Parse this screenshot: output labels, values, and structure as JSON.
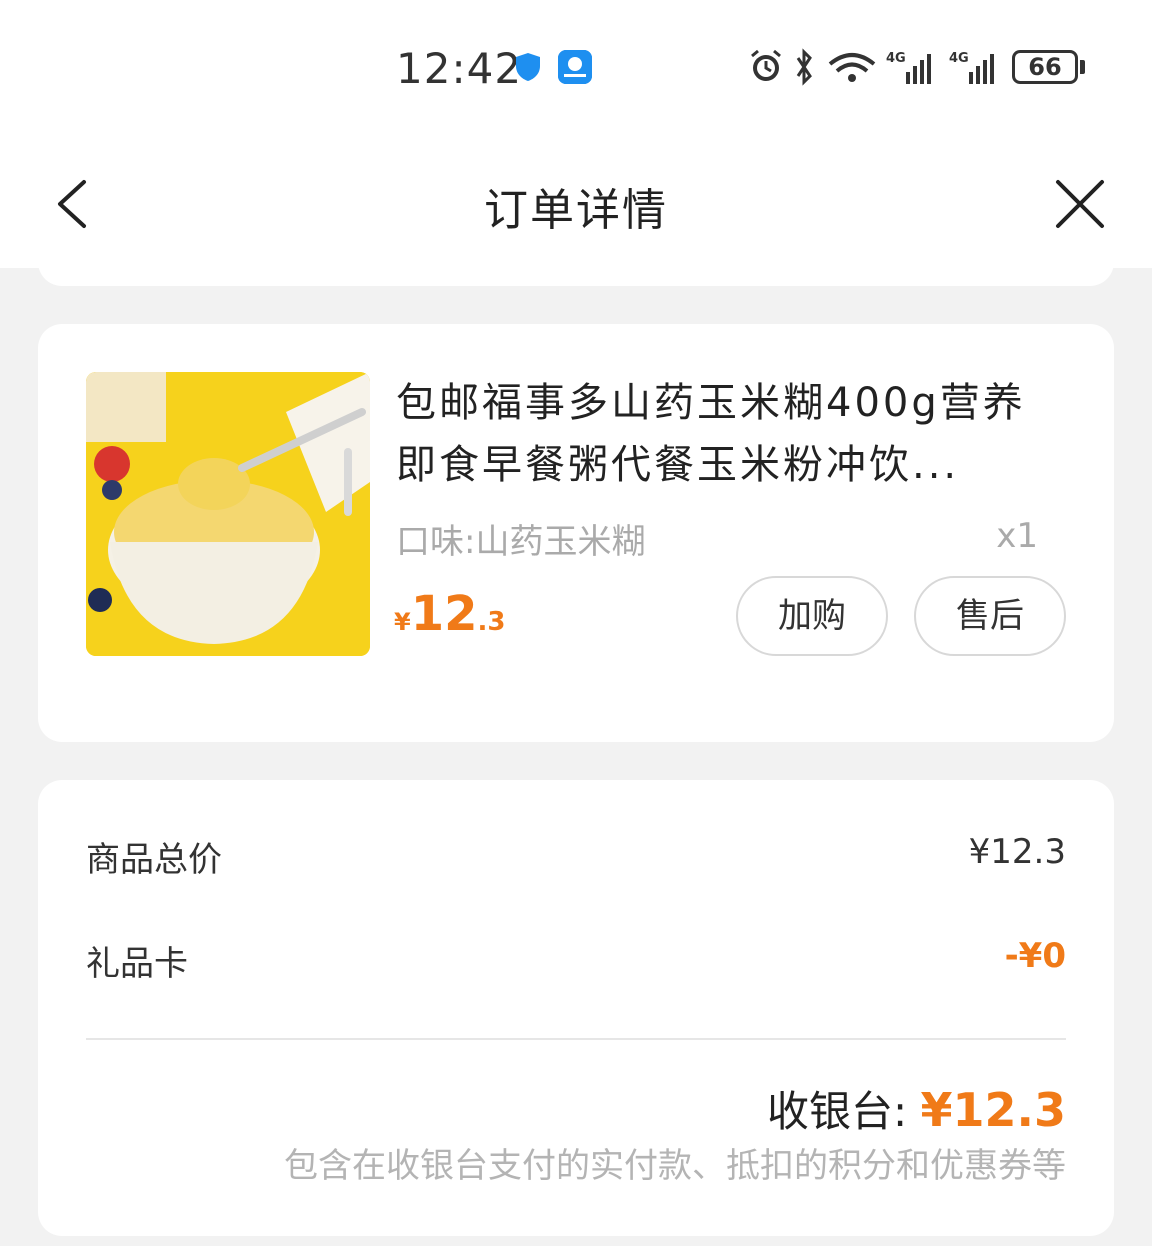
{
  "status_bar": {
    "time": "12:42",
    "network_labels": [
      "4G",
      "4G"
    ],
    "battery": "66"
  },
  "nav": {
    "title": "订单详情"
  },
  "product": {
    "title": "包邮福事多山药玉米糊400g营养即食早餐粥代餐玉米粉冲饮...",
    "spec": "口味:山药玉米糊",
    "quantity": "x1",
    "price_currency": "¥",
    "price_int": "12",
    "price_dec": ".3",
    "buttons": {
      "add_cart": "加购",
      "after_sale": "售后"
    }
  },
  "summary": {
    "rows": [
      {
        "label": "商品总价",
        "value": "¥12.3"
      },
      {
        "label": "礼品卡",
        "value": "-¥0"
      }
    ],
    "total_label": "收银台: ",
    "total_value": "¥12.3",
    "note": "包含在收银台支付的实付款、抵扣的积分和优惠券等"
  },
  "colors": {
    "accent": "#f07a18",
    "background": "#f2f2f2"
  }
}
